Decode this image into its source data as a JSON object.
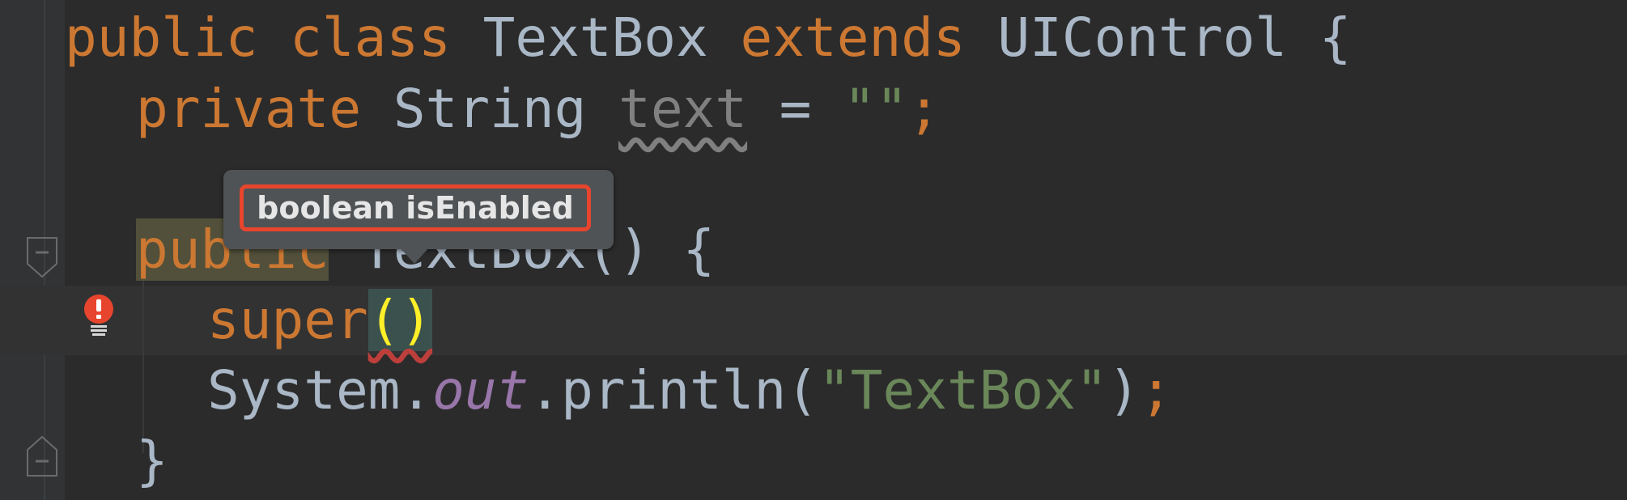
{
  "editor": {
    "line1": {
      "kw_public": "public",
      "kw_class": "class",
      "class_name": "TextBox",
      "kw_extends": "extends",
      "parent": "UIControl",
      "brace": "{"
    },
    "line2": {
      "kw_private": "private",
      "type": "String",
      "var": "text",
      "assign": "=",
      "value": "\"\"",
      "semi": ";"
    },
    "line4": {
      "kw_public": "public",
      "ctor": "TextBox",
      "rest": "() {"
    },
    "line5": {
      "kw_super": "super",
      "paren": "()"
    },
    "line6": {
      "obj": "System.",
      "field": "out",
      "call": ".println(",
      "arg": "\"TextBox\"",
      "close": ")",
      "semi": ";"
    },
    "line7": {
      "brace": "}"
    }
  },
  "tooltip": {
    "text": "boolean isEnabled"
  },
  "icons": [
    "fold-open-icon",
    "fold-close-icon",
    "error-bulb-icon"
  ],
  "colors": {
    "keyword": "#cc7832",
    "string": "#6a8759",
    "field": "#9876aa",
    "text": "#a9b7c6",
    "error": "#bc3f3c",
    "highlight_box": "#e8452e"
  }
}
